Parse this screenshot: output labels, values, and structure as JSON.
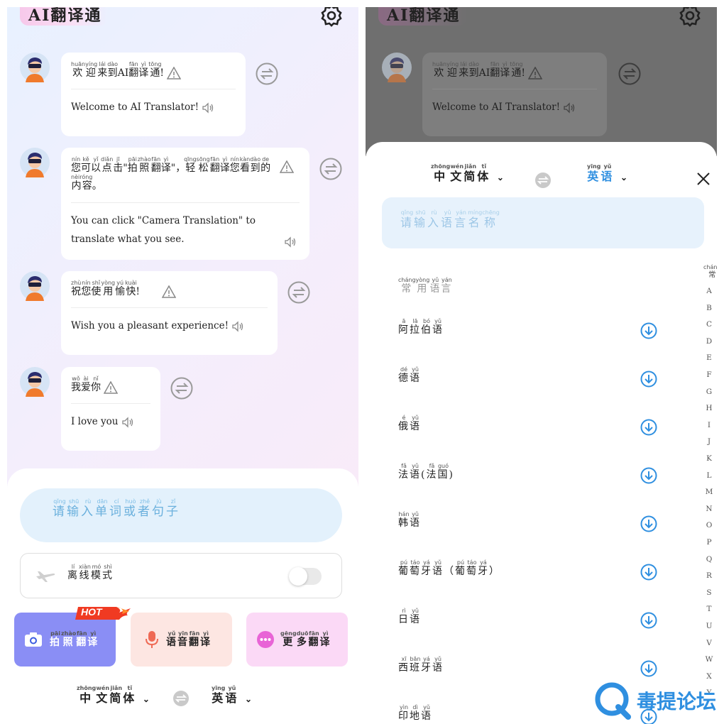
{
  "app": {
    "title": "AI翻译通"
  },
  "chat": {
    "messages": [
      {
        "zh_ruby": [
          [
            "欢迎",
            "huānyíng"
          ],
          [
            "来",
            "lái"
          ],
          [
            "到",
            "dào"
          ],
          [
            "AI",
            ""
          ],
          [
            "翻",
            "fān"
          ],
          [
            "译",
            "yì"
          ],
          [
            "通",
            "tōng"
          ],
          [
            "!",
            ""
          ]
        ],
        "en": "Welcome to AI Translator!"
      },
      {
        "zh_ruby": [
          [
            "您",
            "nín"
          ],
          [
            "可",
            "kě"
          ],
          [
            "以",
            "yǐ"
          ],
          [
            "点",
            "diǎn"
          ],
          [
            "击",
            "jī"
          ],
          [
            "\"",
            ""
          ],
          [
            "拍",
            "pāi"
          ],
          [
            "照",
            "zhào"
          ],
          [
            "翻",
            "fān"
          ],
          [
            "译",
            "yì"
          ],
          [
            "\"，",
            ""
          ],
          [
            "轻松",
            "qīngsōng"
          ],
          [
            "翻",
            "fān"
          ],
          [
            "译",
            "yì"
          ],
          [
            "您",
            "nín"
          ],
          [
            "看",
            "kàn"
          ],
          [
            "到",
            "dào"
          ],
          [
            "的",
            "de"
          ],
          [
            "内容",
            "nèiróng"
          ],
          [
            "。",
            ""
          ]
        ],
        "en": "You can click \"Camera Translation\" to translate what you see."
      },
      {
        "zh_ruby": [
          [
            "祝",
            "zhù"
          ],
          [
            "您",
            "nín"
          ],
          [
            "使",
            "shǐ"
          ],
          [
            "用",
            "yòng"
          ],
          [
            "愉",
            "yú"
          ],
          [
            "快",
            "kuài"
          ],
          [
            "!",
            ""
          ]
        ],
        "en": "Wish you a pleasant experience!"
      },
      {
        "zh_ruby": [
          [
            "我",
            "wǒ"
          ],
          [
            "爱",
            "ài"
          ],
          [
            "你",
            "nǐ"
          ]
        ],
        "en": "I love you"
      }
    ]
  },
  "input": {
    "placeholder_ruby": [
      [
        "请",
        "qǐng"
      ],
      [
        "输",
        "shū"
      ],
      [
        "入",
        "rù"
      ],
      [
        "单",
        "dān"
      ],
      [
        "词",
        "cí"
      ],
      [
        "或",
        "huò"
      ],
      [
        "者",
        "zhě"
      ],
      [
        "句",
        "jù"
      ],
      [
        "子",
        "zǐ"
      ]
    ]
  },
  "offline": {
    "label_ruby": [
      [
        "离",
        "lí"
      ],
      [
        "线",
        "xiàn"
      ],
      [
        "模",
        "mó"
      ],
      [
        "式",
        "shì"
      ]
    ],
    "enabled": false
  },
  "features": [
    {
      "label_ruby": [
        [
          "拍",
          "pāi"
        ],
        [
          "照",
          "zhào"
        ],
        [
          "翻",
          "fān"
        ],
        [
          "译",
          "yì"
        ]
      ],
      "badge": "HOT",
      "bg": "#8a8ef5",
      "fg": "#ffffff",
      "icon": "camera-icon"
    },
    {
      "label_ruby": [
        [
          "语",
          "yǔ"
        ],
        [
          "音",
          "yīn"
        ],
        [
          "翻",
          "fān"
        ],
        [
          "译",
          "yì"
        ]
      ],
      "badge": "",
      "bg": "#fde6e2",
      "fg": "#222222",
      "icon": "microphone-icon"
    },
    {
      "label_ruby": [
        [
          "更",
          "gēng"
        ],
        [
          "多",
          "duō"
        ],
        [
          "翻",
          "fān"
        ],
        [
          "译",
          "yì"
        ]
      ],
      "badge": "",
      "bg": "#fbd9f6",
      "fg": "#222222",
      "icon": "more-icon"
    }
  ],
  "lang_bar": {
    "source_ruby": [
      [
        "中",
        "zhōng"
      ],
      [
        "文",
        "wén"
      ],
      [
        "简",
        "jiǎn"
      ],
      [
        "体",
        "tǐ"
      ]
    ],
    "target_ruby": [
      [
        "英",
        "yīng"
      ],
      [
        "语",
        "yǔ"
      ]
    ]
  },
  "picker": {
    "source_ruby": [
      [
        "中",
        "zhōng"
      ],
      [
        "文",
        "wén"
      ],
      [
        "简",
        "jiǎn"
      ],
      [
        "体",
        "tǐ"
      ]
    ],
    "target_ruby": [
      [
        "英",
        "yīng"
      ],
      [
        "语",
        "yǔ"
      ]
    ],
    "search_ruby": [
      [
        "请",
        "qǐng"
      ],
      [
        "输",
        "shū"
      ],
      [
        "入",
        "rù"
      ],
      [
        "语",
        "yǔ"
      ],
      [
        "言",
        "yán"
      ],
      [
        "名",
        "míng"
      ],
      [
        "称",
        "chēng"
      ]
    ],
    "section_ruby": [
      [
        "常",
        "cháng"
      ],
      [
        "用",
        "yòng"
      ],
      [
        "语",
        "yǔ"
      ],
      [
        "言",
        "yán"
      ]
    ],
    "languages": [
      [
        [
          "阿",
          "ā"
        ],
        [
          "拉",
          "lā"
        ],
        [
          "伯",
          "bó"
        ],
        [
          "语",
          "yǔ"
        ]
      ],
      [
        [
          "德",
          "dé"
        ],
        [
          "语",
          "yǔ"
        ]
      ],
      [
        [
          "俄",
          "é"
        ],
        [
          "语",
          "yǔ"
        ]
      ],
      [
        [
          "法",
          "fǎ"
        ],
        [
          "语",
          "yǔ"
        ],
        [
          "(",
          ""
        ],
        [
          "法",
          "fǎ"
        ],
        [
          "国",
          "guó"
        ],
        [
          ")",
          ""
        ]
      ],
      [
        [
          "韩",
          "hán"
        ],
        [
          "语",
          "yǔ"
        ]
      ],
      [
        [
          "葡",
          "pú"
        ],
        [
          "萄",
          "táo"
        ],
        [
          "牙",
          "yá"
        ],
        [
          "语",
          "yǔ"
        ],
        [
          "（",
          ""
        ],
        [
          "葡",
          "pú"
        ],
        [
          "萄",
          "táo"
        ],
        [
          "牙",
          "yá"
        ],
        [
          "）",
          ""
        ]
      ],
      [
        [
          "日",
          "rì"
        ],
        [
          "语",
          "yǔ"
        ]
      ],
      [
        [
          "西",
          "xī"
        ],
        [
          "班",
          "bān"
        ],
        [
          "牙",
          "yá"
        ],
        [
          "语",
          "yǔ"
        ]
      ],
      [
        [
          "印",
          "yìn"
        ],
        [
          "地",
          "dì"
        ],
        [
          "语",
          "yǔ"
        ]
      ]
    ],
    "index_first_ruby": [
      [
        "常",
        "cháng"
      ]
    ],
    "index_letters": [
      "A",
      "B",
      "C",
      "D",
      "E",
      "F",
      "G",
      "H",
      "I",
      "J",
      "K",
      "L",
      "M",
      "N",
      "O",
      "P",
      "Q",
      "R",
      "S",
      "T",
      "U",
      "V",
      "W",
      "X",
      "Y"
    ]
  },
  "watermark": {
    "text": "毒提论坛"
  },
  "colors": {
    "accent": "#2f8fe0",
    "swap_gray": "#b5b5b5"
  }
}
